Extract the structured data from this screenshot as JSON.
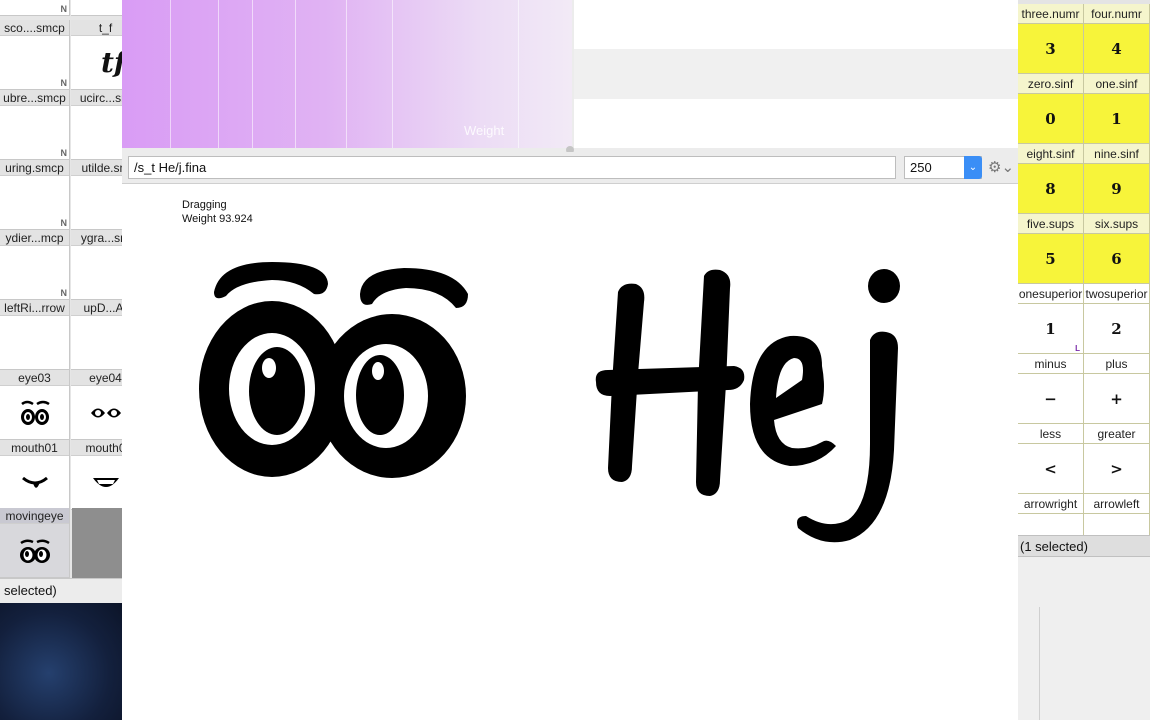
{
  "left_panel": {
    "cells": [
      {
        "label": "",
        "mark": "N"
      },
      {
        "label": "",
        "mark": ""
      },
      {
        "label": "sco....smcp",
        "mark": "N"
      },
      {
        "label": "t_f",
        "mark": ""
      },
      {
        "label": "ubre...smcp",
        "mark": "N"
      },
      {
        "label": "ucirc...sm",
        "mark": ""
      },
      {
        "label": "uring.smcp",
        "mark": "N"
      },
      {
        "label": "utilde.sm",
        "mark": ""
      },
      {
        "label": "ydier...mcp",
        "mark": "N"
      },
      {
        "label": "ygra...sm",
        "mark": ""
      },
      {
        "label": "leftRi...rrow",
        "mark": ""
      },
      {
        "label": "upD...Ar",
        "mark": ""
      },
      {
        "label": "eye03",
        "mark": ""
      },
      {
        "label": "eye04",
        "mark": ""
      },
      {
        "label": "mouth01",
        "mark": ""
      },
      {
        "label": "mouth0",
        "mark": ""
      },
      {
        "label": "movingeye",
        "mark": ""
      }
    ],
    "tf_glyph": "tf",
    "status": "selected)"
  },
  "top_panel": {
    "weight_label": "Weight"
  },
  "input_bar": {
    "text": "/s_t   He/j.fina",
    "size_value": "250",
    "size_arrow": "⌄",
    "gear": "⚙⌄"
  },
  "canvas": {
    "status_line1": "Dragging",
    "status_line2": "Weight 93.924",
    "preview_word": "Hej"
  },
  "right_panel": {
    "rows": [
      {
        "left": {
          "label": "three.numr",
          "glyph": "3"
        },
        "right": {
          "label": "four.numr",
          "glyph": "4"
        }
      },
      {
        "left": {
          "label": "zero.sinf",
          "glyph": "0"
        },
        "right": {
          "label": "one.sinf",
          "glyph": "1"
        }
      },
      {
        "left": {
          "label": "eight.sinf",
          "glyph": "8"
        },
        "right": {
          "label": "nine.sinf",
          "glyph": "9"
        }
      },
      {
        "left": {
          "label": "five.sups",
          "glyph": "5"
        },
        "right": {
          "label": "six.sups",
          "glyph": "6"
        }
      },
      {
        "left": {
          "label": "onesuperior",
          "glyph": "1",
          "white": true
        },
        "right": {
          "label": "twosuperior",
          "glyph": "2",
          "white": true
        }
      },
      {
        "left": {
          "label": "minus",
          "glyph": "−",
          "white": true
        },
        "right": {
          "label": "plus",
          "glyph": "+",
          "white": true
        }
      },
      {
        "left": {
          "label": "less",
          "glyph": "<",
          "white": true
        },
        "right": {
          "label": "greater",
          "glyph": ">",
          "white": true
        }
      },
      {
        "left": {
          "label": "arrowright",
          "glyph": "",
          "white": true
        },
        "right": {
          "label": "arrowleft",
          "glyph": "",
          "white": true
        }
      }
    ],
    "mark_l": "L",
    "status": "(1 selected)"
  },
  "colors": {
    "gradient_start": "#d99cf5",
    "gradient_end": "#f2eaf6",
    "yellow_cell": "#f7f43a",
    "accent_blue": "#3a8ef6"
  }
}
